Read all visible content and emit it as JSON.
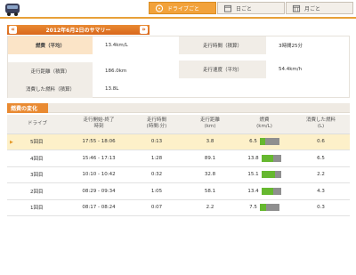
{
  "tabs": [
    {
      "label": "ドライブごと",
      "active": true,
      "icon": "steering-wheel-icon"
    },
    {
      "label": "日ごと",
      "active": false,
      "icon": "calendar-day-icon"
    },
    {
      "label": "月ごと",
      "active": false,
      "icon": "calendar-month-icon"
    }
  ],
  "summary": {
    "title": "2012年6月2日のサマリー",
    "prev": "«",
    "next": "»",
    "fuel_econ_label": "燃費（平均）",
    "fuel_econ_value": "13.4km/L",
    "drive_time_label": "走行時間（積算）",
    "drive_time_value": "3時間25分",
    "distance_label": "走行距離（積算）",
    "distance_value": "186.0km",
    "speed_label": "走行速度（平均）",
    "speed_value": "54.4km/h",
    "fuel_used_label": "消費した燃料（積算）",
    "fuel_used_value": "13.8L"
  },
  "section": {
    "title": "燃費の変化"
  },
  "table": {
    "headers": {
      "drive": "ドライブ",
      "time_line1": "走行開始-終了",
      "time_line2": "時刻",
      "duration_line1": "走行時間",
      "duration_line2": "(時間:分)",
      "distance_line1": "走行距離",
      "distance_line2": "(km)",
      "econ_line1": "燃費",
      "econ_line2": "(km/L)",
      "fuel_line1": "消費した燃料",
      "fuel_line2": "(L)"
    },
    "rows": [
      {
        "drive": "5回目",
        "time": "17:55 - 18:06",
        "duration": "0:13",
        "distance": "3.8",
        "econ": "6.5",
        "fuel": "0.6",
        "selected": true,
        "econ_fraction": 0.3
      },
      {
        "drive": "4回目",
        "time": "15:46 - 17:13",
        "duration": "1:28",
        "distance": "89.1",
        "econ": "13.8",
        "fuel": "6.5",
        "selected": false,
        "econ_fraction": 0.62
      },
      {
        "drive": "3回目",
        "time": "10:10 - 10:42",
        "duration": "0:32",
        "distance": "32.8",
        "econ": "15.1",
        "fuel": "2.2",
        "selected": false,
        "econ_fraction": 0.68
      },
      {
        "drive": "2回目",
        "time": "08:29 - 09:34",
        "duration": "1:05",
        "distance": "58.1",
        "econ": "13.4",
        "fuel": "4.3",
        "selected": false,
        "econ_fraction": 0.6
      },
      {
        "drive": "1回目",
        "time": "08:17 - 08:24",
        "duration": "0:07",
        "distance": "2.2",
        "econ": "7.5",
        "fuel": "0.3",
        "selected": false,
        "econ_fraction": 0.34
      }
    ]
  }
}
